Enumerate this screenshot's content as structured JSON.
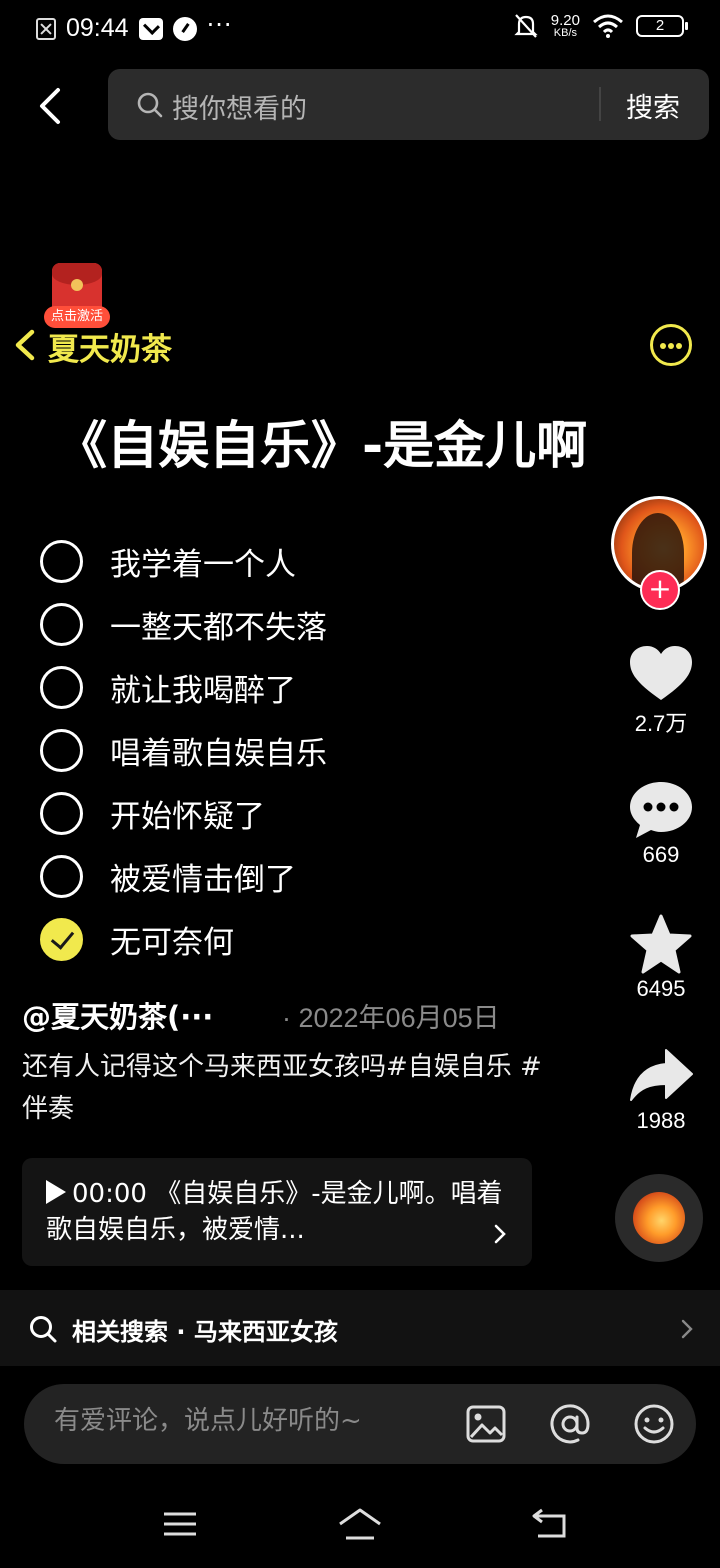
{
  "status_bar": {
    "time": "09:44",
    "network_speed_value": "9.20",
    "network_speed_unit": "KB/s",
    "battery": "2"
  },
  "search": {
    "placeholder": "搜你想看的",
    "button_label": "搜索"
  },
  "red_packet": {
    "tag": "点击激活"
  },
  "album": {
    "name": "夏天奶茶"
  },
  "song_title": "《自娱自乐》-是金儿啊",
  "lyrics": [
    {
      "text": "我学着一个人",
      "checked": false
    },
    {
      "text": "一整天都不失落",
      "checked": false
    },
    {
      "text": "就让我喝醉了",
      "checked": false
    },
    {
      "text": "唱着歌自娱自乐",
      "checked": false
    },
    {
      "text": "开始怀疑了",
      "checked": false
    },
    {
      "text": "被爱情击倒了",
      "checked": false
    },
    {
      "text": "无可奈何",
      "checked": true
    }
  ],
  "rail": {
    "likes": "2.7万",
    "comments": "669",
    "favorites": "6495",
    "shares": "1988"
  },
  "post": {
    "author": "@夏天奶茶(···",
    "date": "· 2022年06月05日",
    "caption": "还有人记得这个马来西亚女孩吗#自娱自乐 #伴奏"
  },
  "lyric_card": {
    "text": "00:00 《自娱自乐》-是金儿啊。唱着歌自娱自乐，被爱情..."
  },
  "related_search": {
    "text": "相关搜索 · 马来西亚女孩"
  },
  "comment_bar": {
    "placeholder": "有爱评论，说点儿好听的~"
  },
  "colors": {
    "accent_yellow": "#f1e94d",
    "follow_red": "#fe2c55",
    "background": "#000000"
  }
}
